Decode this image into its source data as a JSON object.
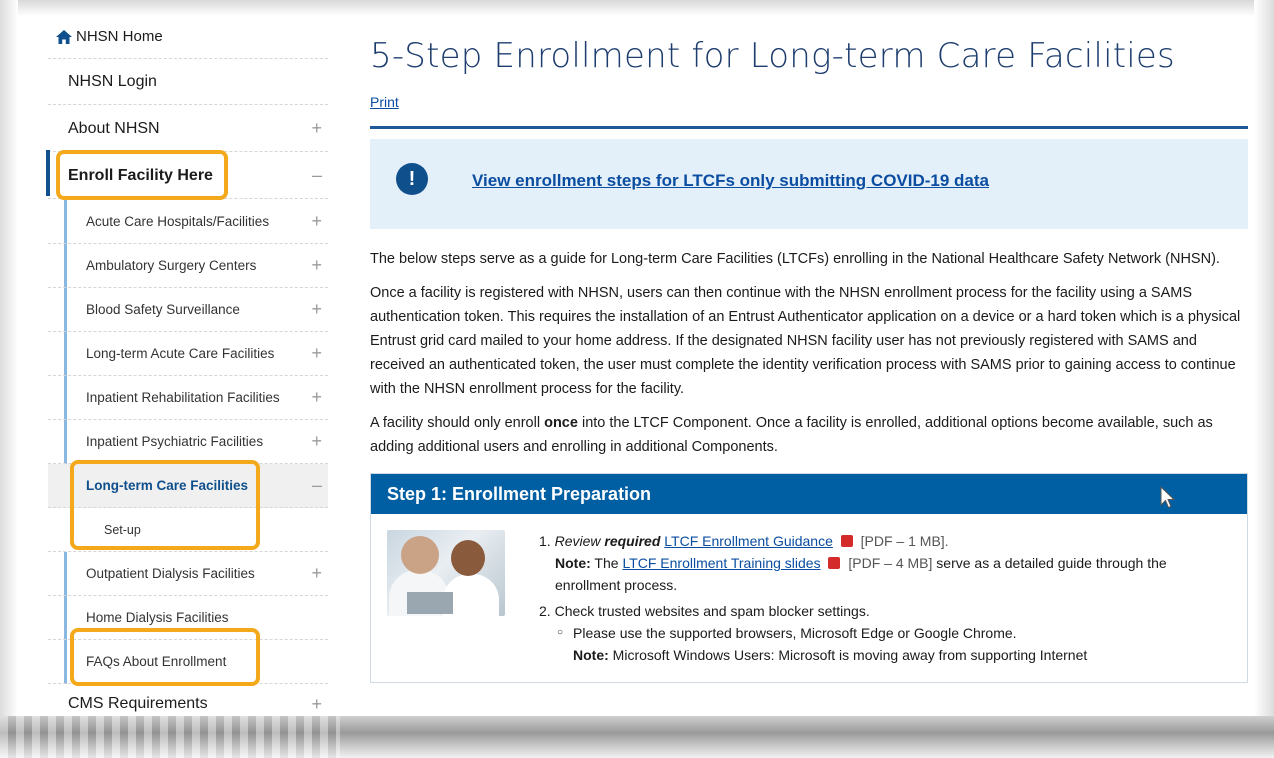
{
  "sidebar": {
    "home": "NHSN Home",
    "login": "NHSN Login",
    "about": "About NHSN",
    "enroll": "Enroll Facility Here",
    "sub_items": [
      "Acute Care Hospitals/Facilities",
      "Ambulatory Surgery Centers",
      "Blood Safety Surveillance",
      "Long-term Acute Care Facilities",
      "Inpatient Rehabilitation Facilities",
      "Inpatient Psychiatric Facilities"
    ],
    "ltc": "Long-term Care Facilities",
    "setup": "Set-up",
    "outpatient": "Outpatient Dialysis Facilities",
    "home_dialysis": "Home Dialysis Facilities",
    "faqs": "FAQs About Enrollment",
    "cms": "CMS Requirements",
    "plus": "+",
    "minus": "–"
  },
  "main": {
    "title": "5-Step Enrollment for Long-term Care Facilities",
    "print": "Print",
    "alert_icon": "!",
    "alert_link": "View enrollment steps for LTCFs only submitting COVID-19 data",
    "para1": "The below steps serve as a guide for Long-term Care Facilities (LTCFs) enrolling in the National Healthcare Safety Network (NHSN).",
    "para2": "Once a facility is registered with NHSN, users can then continue with the NHSN enrollment process for the facility using a SAMS authentication token. This requires the installation of an Entrust Authenticator application on a device or a hard token which is a physical Entrust grid card mailed to your home address. If the designated NHSN facility user has not previously registered with SAMS and received an authenticated token, the user must complete the identity verification process with SAMS prior to gaining access to continue with the NHSN enrollment process for the facility.",
    "para3_a": "A facility should only enroll ",
    "para3_b": "once",
    "para3_c": " into the LTCF Component. Once a facility is enrolled, additional options become available, such as adding additional users and enrolling in additional Components.",
    "step1": {
      "heading": "Step 1: Enrollment Preparation",
      "item1_num": "1.",
      "item1_review": "Review",
      "item1_required": "required",
      "item1_link": "LTCF Enrollment Guidance",
      "item1_size": "[PDF – 1 MB].",
      "note1_label": "Note:",
      "note1_pre": "The",
      "note1_link": "LTCF Enrollment Training slides",
      "note1_size": "[PDF – 4 MB]",
      "note1_post": "serve as a detailed guide through the enrollment process.",
      "item2_num": "2.",
      "item2_text": "Check trusted websites and spam blocker settings.",
      "bullet1": "Please use the supported browsers, Microsoft Edge or Google Chrome.",
      "note2_label": "Note:",
      "note2_text": "Microsoft Windows Users: Microsoft is moving away from supporting Internet"
    }
  },
  "colors": {
    "brand_blue": "#005ea2",
    "title_navy": "#1d3d6e",
    "highlight_orange": "#f4a91c",
    "alert_bg": "#e4f0f9"
  },
  "icons": [
    "home-icon",
    "alert-icon",
    "pdf-icon",
    "cursor-icon"
  ]
}
